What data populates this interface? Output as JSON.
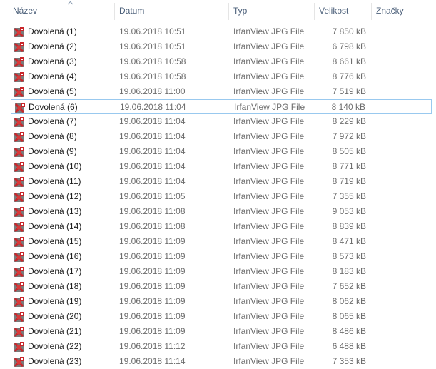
{
  "columns": [
    {
      "key": "name",
      "label": "Název"
    },
    {
      "key": "date",
      "label": "Datum"
    },
    {
      "key": "type",
      "label": "Typ"
    },
    {
      "key": "size",
      "label": "Velikost"
    },
    {
      "key": "tags",
      "label": "Značky"
    }
  ],
  "sort": {
    "column": "name",
    "direction": "ascending",
    "icon": "sort-up-chevron-icon"
  },
  "file_icon": "irfanview-jpg-icon",
  "focused_row": 5,
  "colors": {
    "header_text": "#4c607a",
    "focus_border": "#99c9ef",
    "icon_red": "#c8262b"
  },
  "rows": [
    {
      "name": "Dovolená (1)",
      "date": "19.06.2018 10:51",
      "type": "IrfanView JPG File",
      "size": "7 850 kB"
    },
    {
      "name": "Dovolená (2)",
      "date": "19.06.2018 10:51",
      "type": "IrfanView JPG File",
      "size": "6 798 kB"
    },
    {
      "name": "Dovolená (3)",
      "date": "19.06.2018 10:58",
      "type": "IrfanView JPG File",
      "size": "8 661 kB"
    },
    {
      "name": "Dovolená (4)",
      "date": "19.06.2018 10:58",
      "type": "IrfanView JPG File",
      "size": "8 776 kB"
    },
    {
      "name": "Dovolená (5)",
      "date": "19.06.2018 11:00",
      "type": "IrfanView JPG File",
      "size": "7 519 kB"
    },
    {
      "name": "Dovolená (6)",
      "date": "19.06.2018 11:04",
      "type": "IrfanView JPG File",
      "size": "8 140 kB"
    },
    {
      "name": "Dovolená (7)",
      "date": "19.06.2018 11:04",
      "type": "IrfanView JPG File",
      "size": "8 229 kB"
    },
    {
      "name": "Dovolená (8)",
      "date": "19.06.2018 11:04",
      "type": "IrfanView JPG File",
      "size": "7 972 kB"
    },
    {
      "name": "Dovolená (9)",
      "date": "19.06.2018 11:04",
      "type": "IrfanView JPG File",
      "size": "8 505 kB"
    },
    {
      "name": "Dovolená (10)",
      "date": "19.06.2018 11:04",
      "type": "IrfanView JPG File",
      "size": "8 771 kB"
    },
    {
      "name": "Dovolená (11)",
      "date": "19.06.2018 11:04",
      "type": "IrfanView JPG File",
      "size": "8 719 kB"
    },
    {
      "name": "Dovolená (12)",
      "date": "19.06.2018 11:05",
      "type": "IrfanView JPG File",
      "size": "7 355 kB"
    },
    {
      "name": "Dovolená (13)",
      "date": "19.06.2018 11:08",
      "type": "IrfanView JPG File",
      "size": "9 053 kB"
    },
    {
      "name": "Dovolená (14)",
      "date": "19.06.2018 11:08",
      "type": "IrfanView JPG File",
      "size": "8 839 kB"
    },
    {
      "name": "Dovolená (15)",
      "date": "19.06.2018 11:09",
      "type": "IrfanView JPG File",
      "size": "8 471 kB"
    },
    {
      "name": "Dovolená (16)",
      "date": "19.06.2018 11:09",
      "type": "IrfanView JPG File",
      "size": "8 573 kB"
    },
    {
      "name": "Dovolená (17)",
      "date": "19.06.2018 11:09",
      "type": "IrfanView JPG File",
      "size": "8 183 kB"
    },
    {
      "name": "Dovolená (18)",
      "date": "19.06.2018 11:09",
      "type": "IrfanView JPG File",
      "size": "7 652 kB"
    },
    {
      "name": "Dovolená (19)",
      "date": "19.06.2018 11:09",
      "type": "IrfanView JPG File",
      "size": "8 062 kB"
    },
    {
      "name": "Dovolená (20)",
      "date": "19.06.2018 11:09",
      "type": "IrfanView JPG File",
      "size": "8 065 kB"
    },
    {
      "name": "Dovolená (21)",
      "date": "19.06.2018 11:09",
      "type": "IrfanView JPG File",
      "size": "8 486 kB"
    },
    {
      "name": "Dovolená (22)",
      "date": "19.06.2018 11:12",
      "type": "IrfanView JPG File",
      "size": "6 488 kB"
    },
    {
      "name": "Dovolená (23)",
      "date": "19.06.2018 11:14",
      "type": "IrfanView JPG File",
      "size": "7 353 kB"
    }
  ]
}
